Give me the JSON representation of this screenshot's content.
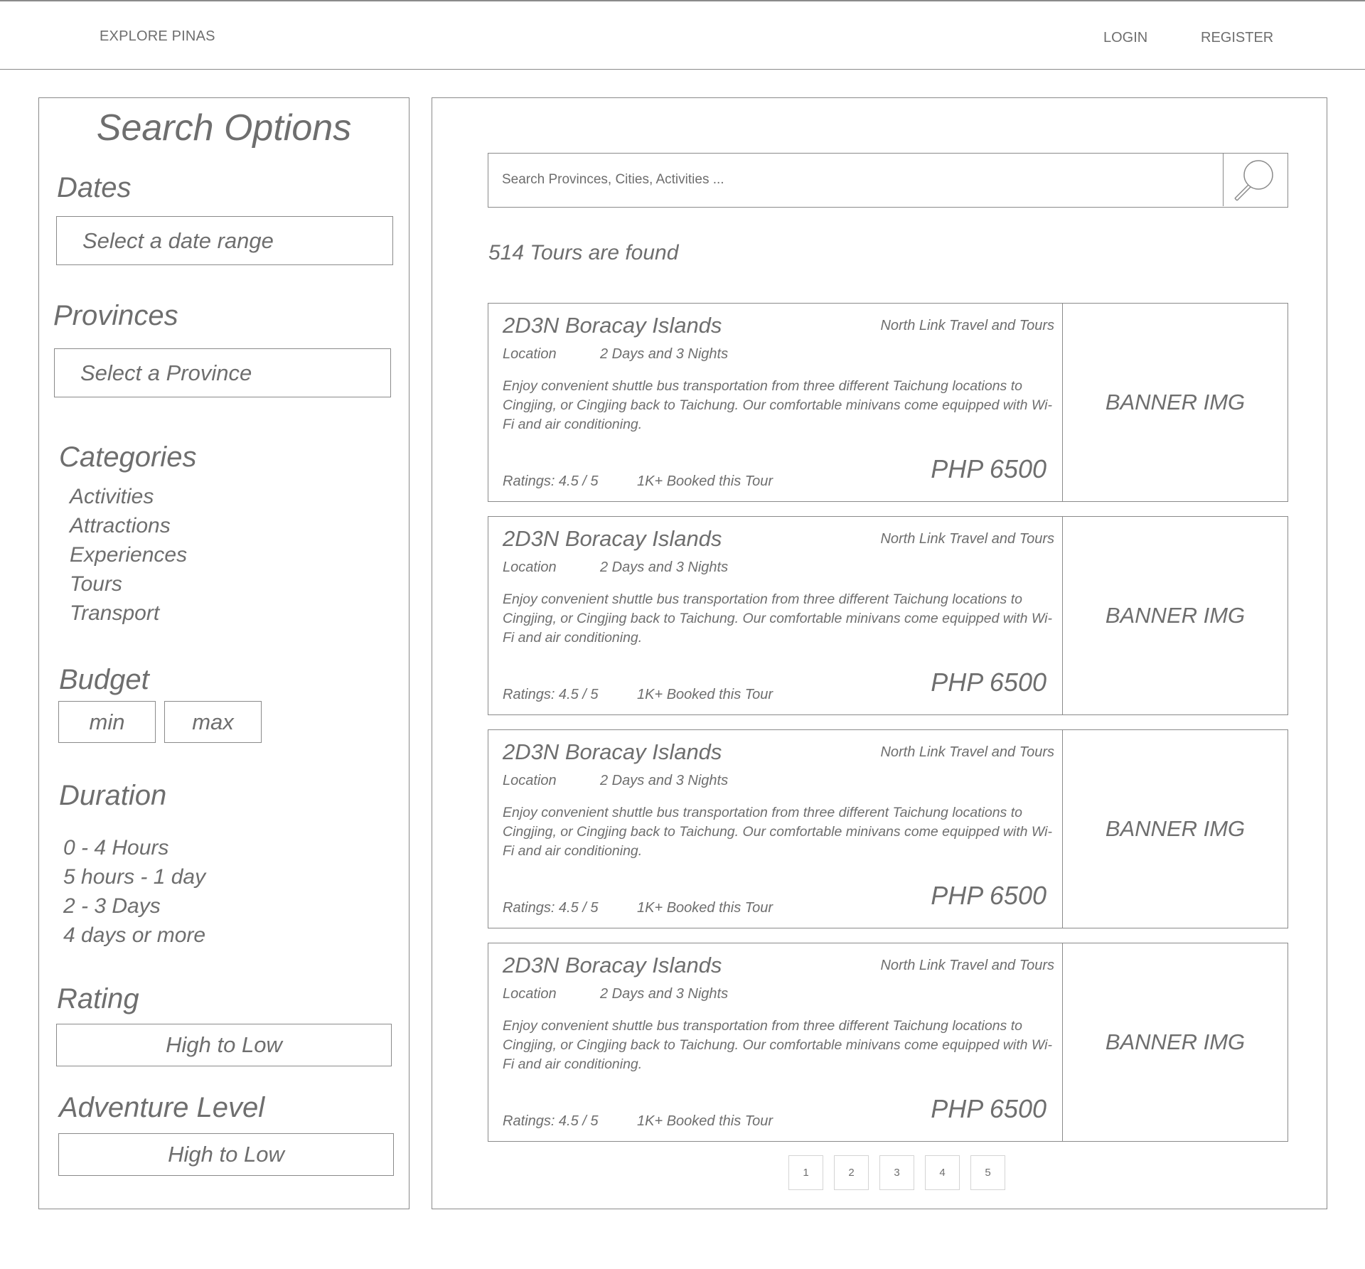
{
  "header": {
    "brand": "EXPLORE PINAS",
    "login": "LOGIN",
    "register": "REGISTER"
  },
  "sidebar": {
    "title": "Search Options",
    "dates_heading": "Dates",
    "dates_value": "Select a date range",
    "provinces_heading": "Provinces",
    "provinces_value": "Select a Province",
    "categories_heading": "Categories",
    "categories": [
      "Activities",
      "Attractions",
      "Experiences",
      "Tours",
      "Transport"
    ],
    "budget_heading": "Budget",
    "budget_min": "min",
    "budget_max": "max",
    "duration_heading": "Duration",
    "durations": [
      "0 - 4 Hours",
      "5 hours - 1 day",
      "2 - 3 Days",
      "4 days or more"
    ],
    "rating_heading": "Rating",
    "rating_value": "High to Low",
    "adventure_heading": "Adventure Level",
    "adventure_value": "High to Low"
  },
  "main": {
    "search_placeholder": "Search Provinces, Cities, Activities ...",
    "result_count": "514 Tours are found",
    "tours": [
      {
        "title": "2D3N Boracay Islands",
        "operator": "North Link Travel and Tours",
        "location": "Location",
        "duration": "2 Days and 3 Nights",
        "description": "Enjoy convenient shuttle bus transportation from three different Taichung locations to Cingjing, or Cingjing back to Taichung. Our comfortable minivans come equipped with Wi-Fi and air conditioning.",
        "rating": "Ratings: 4.5 / 5",
        "booked": "1K+ Booked this Tour",
        "price": "PHP 6500",
        "banner": "BANNER IMG"
      },
      {
        "title": "2D3N Boracay Islands",
        "operator": "North Link Travel and Tours",
        "location": "Location",
        "duration": "2 Days and 3 Nights",
        "description": "Enjoy convenient shuttle bus transportation from three different Taichung locations to Cingjing, or Cingjing back to Taichung. Our comfortable minivans come equipped with Wi-Fi and air conditioning.",
        "rating": "Ratings: 4.5 / 5",
        "booked": "1K+ Booked this Tour",
        "price": "PHP 6500",
        "banner": "BANNER IMG"
      },
      {
        "title": "2D3N Boracay Islands",
        "operator": "North Link Travel and Tours",
        "location": "Location",
        "duration": "2 Days and 3 Nights",
        "description": "Enjoy convenient shuttle bus transportation from three different Taichung locations to Cingjing, or Cingjing back to Taichung. Our comfortable minivans come equipped with Wi-Fi and air conditioning.",
        "rating": "Ratings: 4.5 / 5",
        "booked": "1K+ Booked this Tour",
        "price": "PHP 6500",
        "banner": "BANNER IMG"
      },
      {
        "title": "2D3N Boracay Islands",
        "operator": "North Link Travel and Tours",
        "location": "Location",
        "duration": "2 Days and 3 Nights",
        "description": "Enjoy convenient shuttle bus transportation from three different Taichung locations to Cingjing, or Cingjing back to Taichung. Our comfortable minivans come equipped with Wi-Fi and air conditioning.",
        "rating": "Ratings: 4.5 / 5",
        "booked": "1K+ Booked this Tour",
        "price": "PHP 6500",
        "banner": "BANNER IMG"
      }
    ],
    "pages": [
      "1",
      "2",
      "3",
      "4",
      "5"
    ]
  },
  "icons": {
    "search": "search-icon"
  },
  "colors": {
    "line": "#8a8a8a",
    "text": "#6e6e6e",
    "page_border": "#d4d4d4"
  }
}
